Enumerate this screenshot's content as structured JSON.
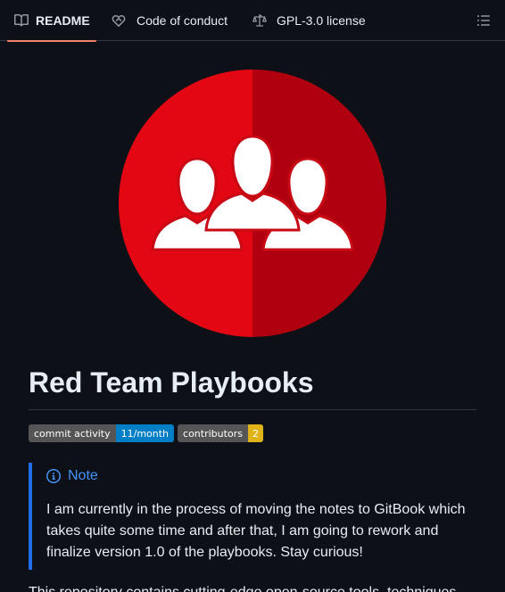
{
  "tabs": [
    {
      "label": "README",
      "icon": "book-icon"
    },
    {
      "label": "Code of conduct",
      "icon": "code-of-conduct-icon"
    },
    {
      "label": "GPL-3.0 license",
      "icon": "law-scale-icon"
    }
  ],
  "outline_icon": "list-unordered-icon",
  "accent_colors": {
    "tab_underline": "#f78166",
    "note_border": "#1f6feb",
    "note_title": "#4493f8",
    "logo_left": "#e30613",
    "logo_right": "#b00010"
  },
  "readme": {
    "title": "Red Team Playbooks",
    "badges": [
      {
        "label": "commit activity",
        "value": "11/month",
        "color": "#007ec6"
      },
      {
        "label": "contributors",
        "value": "2",
        "color": "#dfb317"
      }
    ],
    "note": {
      "title": "Note",
      "body": "I am currently in the process of moving the notes to GitBook which takes quite some time and after that, I am going to rework and finalize version 1.0 of the playbooks. Stay curious!"
    },
    "paragraph_start": "This repository contains cutting-edge open-source tools, techniques,"
  }
}
